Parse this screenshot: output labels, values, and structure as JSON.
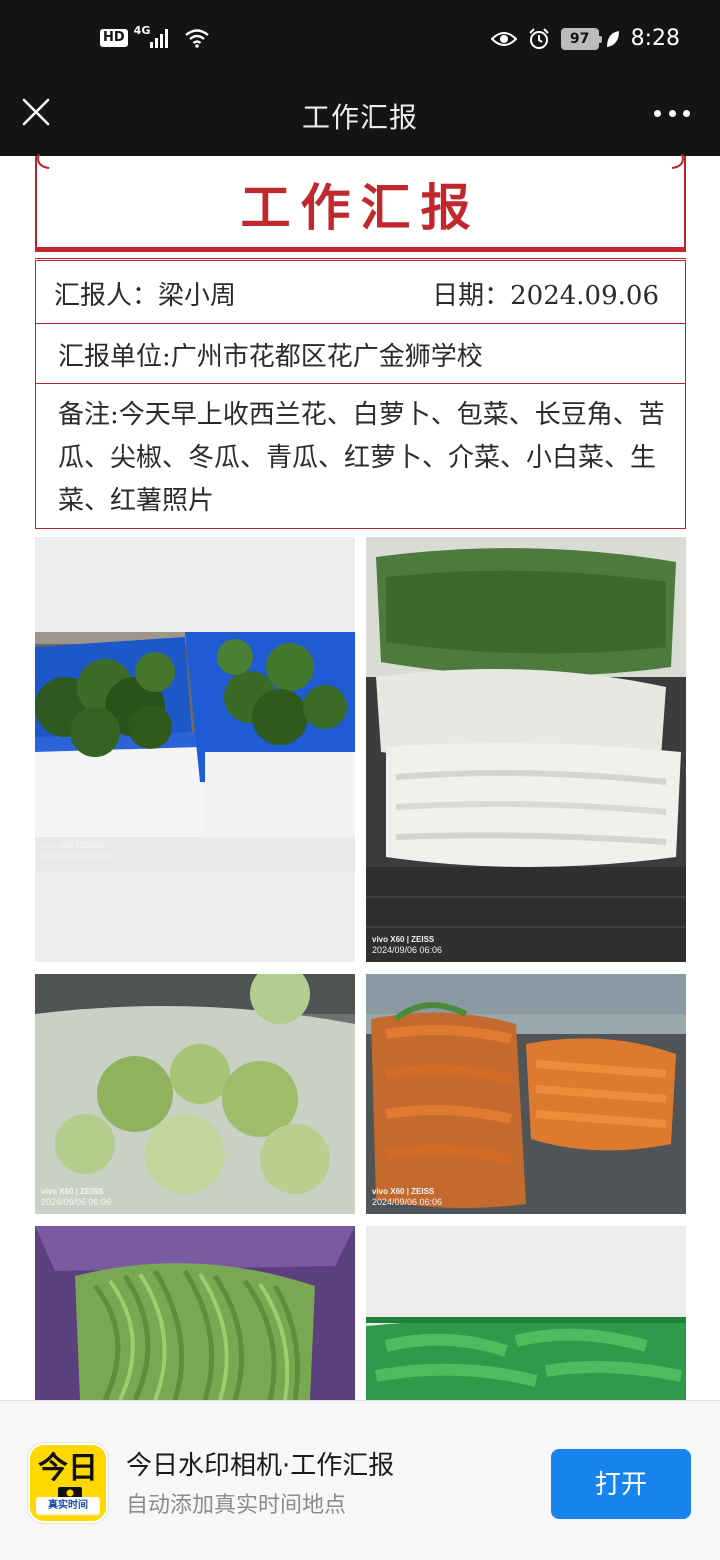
{
  "status_bar": {
    "hd": "HD",
    "network": "4G",
    "battery": "97",
    "time": "8:28"
  },
  "nav": {
    "title": "工作汇报"
  },
  "report": {
    "title": "工作汇报",
    "reporter": "汇报人：梁小周",
    "date": "日期：2024.09.06",
    "unit": "汇报单位:广州市花都区花广金狮学校",
    "notes": "备注:今天早上收西兰花、白萝卜、包菜、长豆角、苦瓜、尖椒、冬瓜、青瓜、红萝卜、介菜、小白菜、生菜、红薯照片"
  },
  "photos": [
    {
      "name": "broccoli-photo",
      "wm_brand": "vivo X60 | ZEISS",
      "wm_date": "2024/09/06 06:06"
    },
    {
      "name": "radish-photo",
      "wm_brand": "vivo X60 | ZEISS",
      "wm_date": "2024/09/06 06:06"
    },
    {
      "name": "cabbage-photo",
      "wm_brand": "vivo X60 | ZEISS",
      "wm_date": "2024/09/06 06:06"
    },
    {
      "name": "carrot-photo",
      "wm_brand": "vivo X60 | ZEISS",
      "wm_date": "2024/09/06 06:06"
    },
    {
      "name": "long-bean-photo",
      "wm_brand": "",
      "wm_date": ""
    },
    {
      "name": "bitter-melon-photo",
      "wm_brand": "",
      "wm_date": ""
    }
  ],
  "banner": {
    "icon_top": "今日",
    "icon_bottom": "真实时间",
    "title": "今日水印相机·工作汇报",
    "subtitle": "自动添加真实时间地点",
    "open_label": "打开"
  },
  "colors": {
    "accent_red": "#c0282e",
    "open_button": "#1a84ee",
    "app_icon_yellow": "#ffd800"
  }
}
